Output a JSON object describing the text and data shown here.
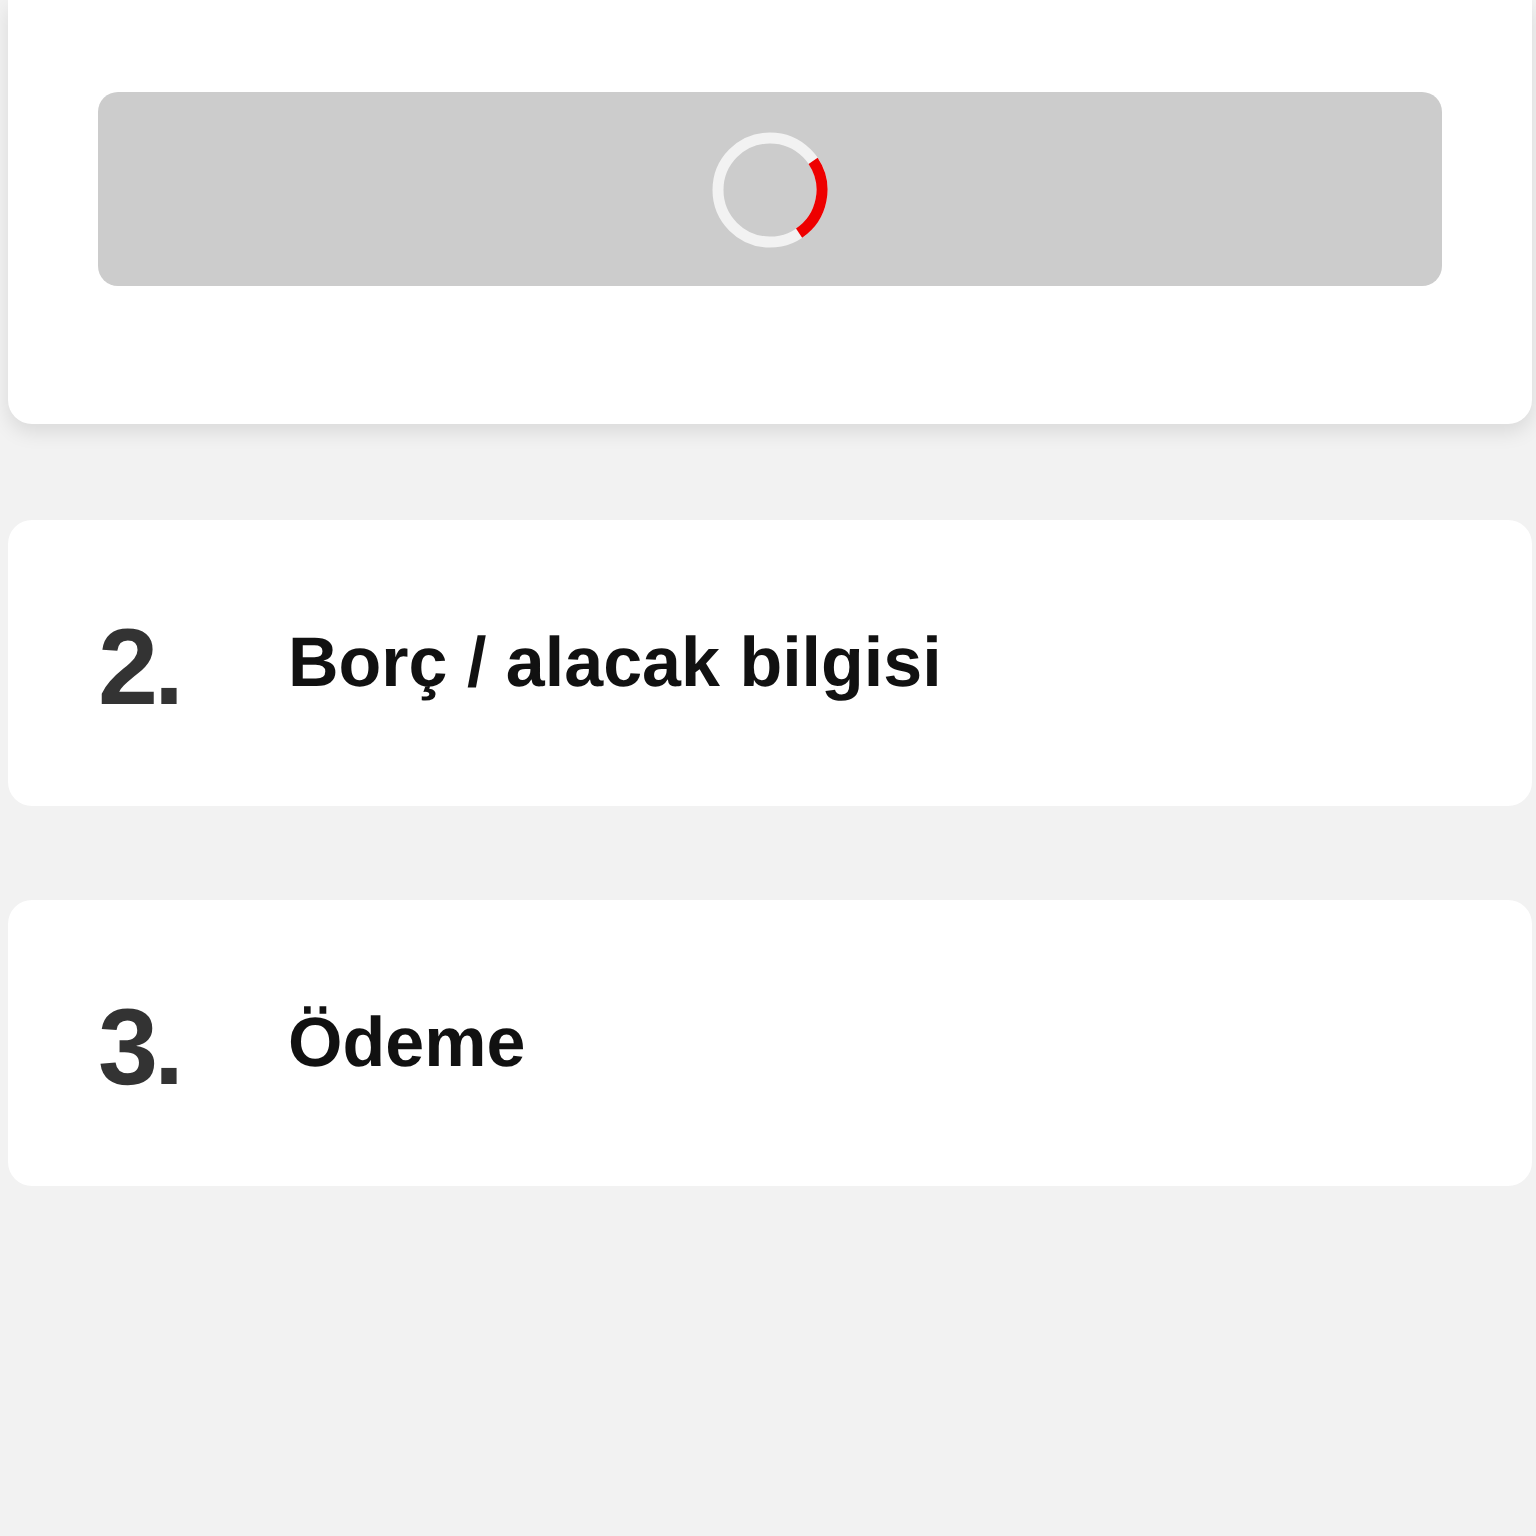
{
  "button": {
    "loading": true
  },
  "steps": [
    {
      "number": "2.",
      "title": "Borç / alacak bilgisi"
    },
    {
      "number": "3.",
      "title": "Ödeme"
    }
  ]
}
